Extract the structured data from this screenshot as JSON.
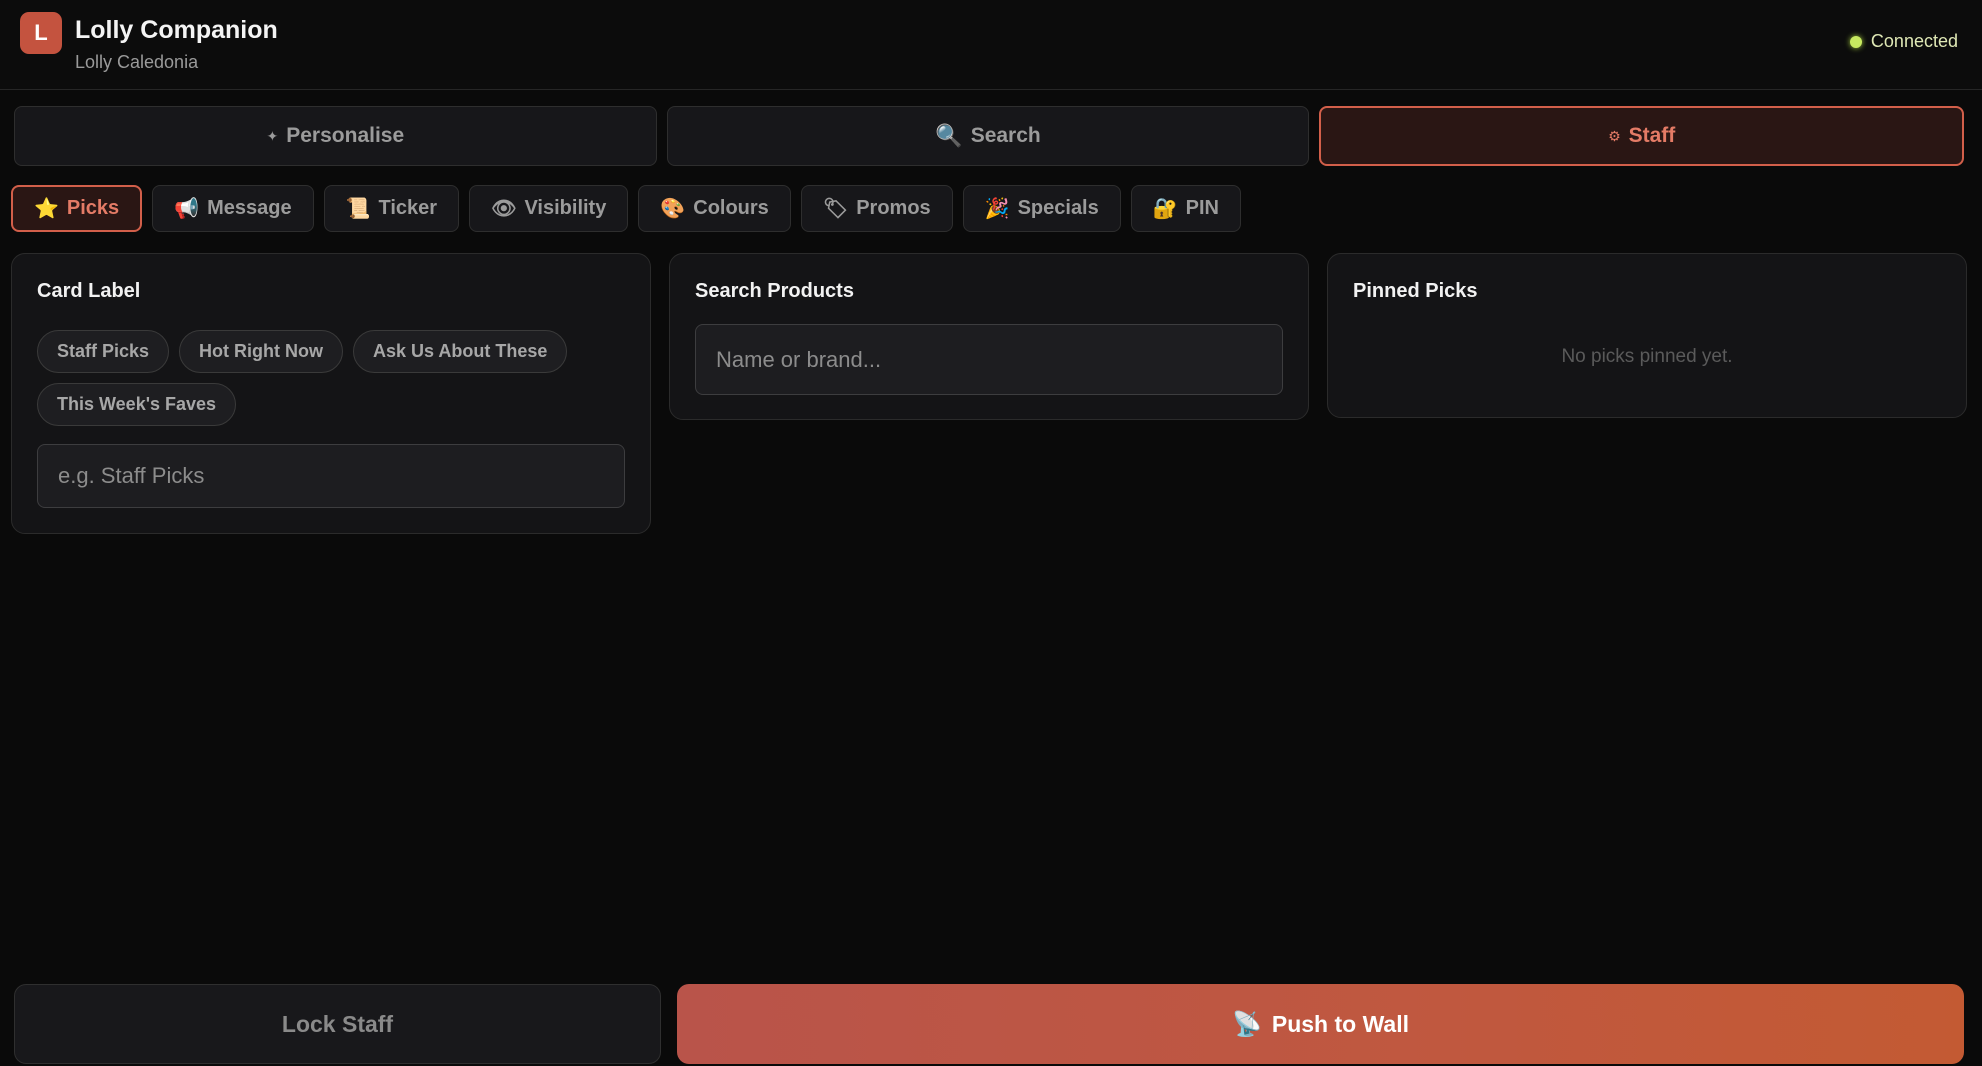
{
  "header": {
    "logo_letter": "L",
    "title": "Lolly Companion",
    "subtitle": "Lolly Caledonia",
    "status": "Connected"
  },
  "mode_tabs": [
    {
      "icon": "✦",
      "label": "Personalise",
      "active": false
    },
    {
      "icon": "🔍",
      "label": "Search",
      "active": false
    },
    {
      "icon": "⚙",
      "label": "Staff",
      "active": true
    }
  ],
  "sub_tabs": [
    {
      "icon": "⭐",
      "label": "Picks",
      "active": true
    },
    {
      "icon": "📢",
      "label": "Message",
      "active": false
    },
    {
      "icon": "📜",
      "label": "Ticker",
      "active": false
    },
    {
      "icon": "👁",
      "label": "Visibility",
      "active": false
    },
    {
      "icon": "🎨",
      "label": "Colours",
      "active": false
    },
    {
      "icon": "🏷",
      "label": "Promos",
      "active": false
    },
    {
      "icon": "🎉",
      "label": "Specials",
      "active": false
    },
    {
      "icon": "🔐",
      "label": "PIN",
      "active": false
    }
  ],
  "card_label": {
    "title": "Card Label",
    "chips": [
      "Staff Picks",
      "Hot Right Now",
      "Ask Us About These",
      "This Week's Faves"
    ],
    "input_value": "",
    "input_placeholder": "e.g. Staff Picks"
  },
  "search_products": {
    "title": "Search Products",
    "input_value": "",
    "input_placeholder": "Name or brand..."
  },
  "pinned_picks": {
    "title": "Pinned Picks",
    "empty_message": "No picks pinned yet."
  },
  "footer": {
    "lock_label": "Lock Staff",
    "push_icon": "📡",
    "push_label": "Push to Wall"
  },
  "colors": {
    "accent": "#d25f4a",
    "push_button": "#c0583f",
    "status_dot": "#c8ea60",
    "background": "#0a0a0a"
  }
}
